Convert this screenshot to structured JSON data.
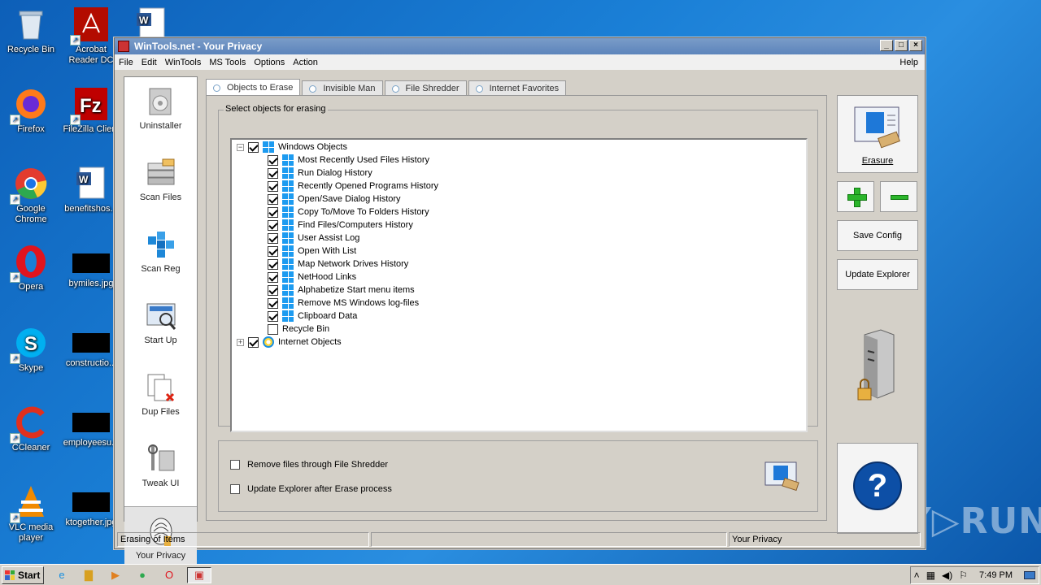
{
  "desktop": {
    "icons": [
      {
        "label": "Recycle Bin",
        "icon": "recycle-bin-icon"
      },
      {
        "label": "Acrobat Reader DC",
        "icon": "acrobat-icon"
      },
      {
        "label": "",
        "icon": "word-doc-icon"
      },
      {
        "label": "Firefox",
        "icon": "firefox-icon"
      },
      {
        "label": "FileZilla Client",
        "icon": "filezilla-icon"
      },
      {
        "label": "Google Chrome",
        "icon": "chrome-icon"
      },
      {
        "label": "benefitshos...",
        "icon": "word-doc-icon"
      },
      {
        "label": "Opera",
        "icon": "opera-icon"
      },
      {
        "label": "bymiles.jpg",
        "icon": "image-file-icon"
      },
      {
        "label": "Skype",
        "icon": "skype-icon"
      },
      {
        "label": "constructio...",
        "icon": "image-file-icon"
      },
      {
        "label": "CCleaner",
        "icon": "ccleaner-icon"
      },
      {
        "label": "employeesu...",
        "icon": "image-file-icon"
      },
      {
        "label": "VLC media player",
        "icon": "vlc-icon"
      },
      {
        "label": "ktogether.jpg",
        "icon": "image-file-icon"
      }
    ],
    "watermark": "ANY▷RUN"
  },
  "window": {
    "title": "WinTools.net - Your Privacy",
    "menu": [
      "File",
      "Edit",
      "WinTools",
      "MS Tools",
      "Options",
      "Action"
    ],
    "help_menu": "Help",
    "sidebar": [
      {
        "label": "Uninstaller",
        "icon": "uninstaller-icon"
      },
      {
        "label": "Scan Files",
        "icon": "scan-files-icon"
      },
      {
        "label": "Scan Reg",
        "icon": "scan-reg-icon"
      },
      {
        "label": "Start Up",
        "icon": "start-up-icon"
      },
      {
        "label": "Dup Files",
        "icon": "dup-files-icon"
      },
      {
        "label": "Tweak UI",
        "icon": "tweak-ui-icon"
      },
      {
        "label": "Your Privacy",
        "icon": "privacy-icon"
      }
    ],
    "tabs": [
      "Objects to Erase",
      "Invisible Man",
      "File Shredder",
      "Internet Favorites"
    ],
    "active_tab": "Objects to Erase",
    "group_label": "Select objects for erasing",
    "tree": {
      "root": {
        "label": "Windows Objects",
        "checked": true,
        "expanded": true
      },
      "items": [
        {
          "label": "Most Recently Used Files History",
          "checked": true
        },
        {
          "label": "Run Dialog History",
          "checked": true
        },
        {
          "label": "Recently Opened Programs History",
          "checked": true
        },
        {
          "label": "Open/Save Dialog History",
          "checked": true
        },
        {
          "label": "Copy To/Move To Folders History",
          "checked": true
        },
        {
          "label": "Find Files/Computers History",
          "checked": true
        },
        {
          "label": "User Assist Log",
          "checked": true
        },
        {
          "label": "Open With List",
          "checked": true
        },
        {
          "label": "Map Network Drives History",
          "checked": true
        },
        {
          "label": "NetHood Links",
          "checked": true
        },
        {
          "label": "Alphabetize Start menu items",
          "checked": true
        },
        {
          "label": "Remove MS Windows log-files",
          "checked": true
        },
        {
          "label": "Clipboard Data",
          "checked": true
        },
        {
          "label": "Recycle Bin",
          "checked": false
        }
      ],
      "root2": {
        "label": "Internet Objects",
        "checked": true,
        "expanded": false
      }
    },
    "options": [
      {
        "label": "Remove files through File Shredder",
        "checked": false
      },
      {
        "label": "Update Explorer after Erase process",
        "checked": false
      }
    ],
    "buttons": {
      "erasure": "Erasure",
      "save_config": "Save Config",
      "update_explorer": "Update Explorer",
      "help": "?"
    },
    "status": {
      "left": "Erasing of Items",
      "middle": "",
      "right": "Your Privacy"
    }
  },
  "taskbar": {
    "start": "Start",
    "clock": "7:49 PM"
  },
  "colors": {
    "desktop": "#1a7fd6",
    "accent_green": "#2bb52b",
    "help_blue": "#0d4fa6"
  }
}
